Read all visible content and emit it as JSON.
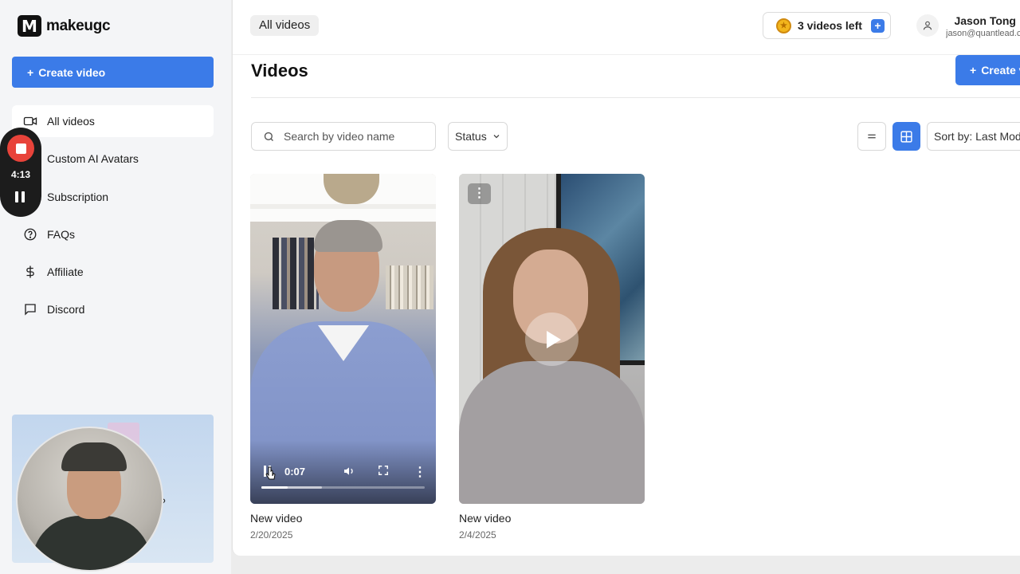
{
  "sidebar": {
    "logo_mark": "M",
    "logo_text": "makeugc",
    "create_label": "Create video",
    "items": [
      {
        "label": "All videos",
        "icon": "video-camera-icon",
        "active": true
      },
      {
        "label": "Custom AI Avatars",
        "icon": "avatar-icon",
        "active": false
      },
      {
        "label": "Subscription",
        "icon": "card-icon",
        "active": false
      },
      {
        "label": "FAQs",
        "icon": "help-circle-icon",
        "active": false
      },
      {
        "label": "Affiliate",
        "icon": "dollar-icon",
        "active": false
      },
      {
        "label": "Discord",
        "icon": "chat-bubble-icon",
        "active": false
      }
    ],
    "promo_text": "?"
  },
  "recorder": {
    "time": "4:13",
    "color": "#e8433a"
  },
  "header": {
    "breadcrumb": "All videos",
    "credits_label": "3 videos left",
    "user_name": "Jason Tong",
    "user_email": "jason@quantlead.co"
  },
  "main": {
    "title": "Videos",
    "create_label": "Create video",
    "search_placeholder": "Search by video name",
    "status_label": "Status",
    "sort_label": "Sort by: Last Modified",
    "accent": "#3b7be8"
  },
  "videos": [
    {
      "title": "New video",
      "date": "2/20/2025",
      "time": "0:07",
      "progress": 0.16,
      "buffered": 0.37
    },
    {
      "title": "New video",
      "date": "2/4/2025"
    }
  ]
}
